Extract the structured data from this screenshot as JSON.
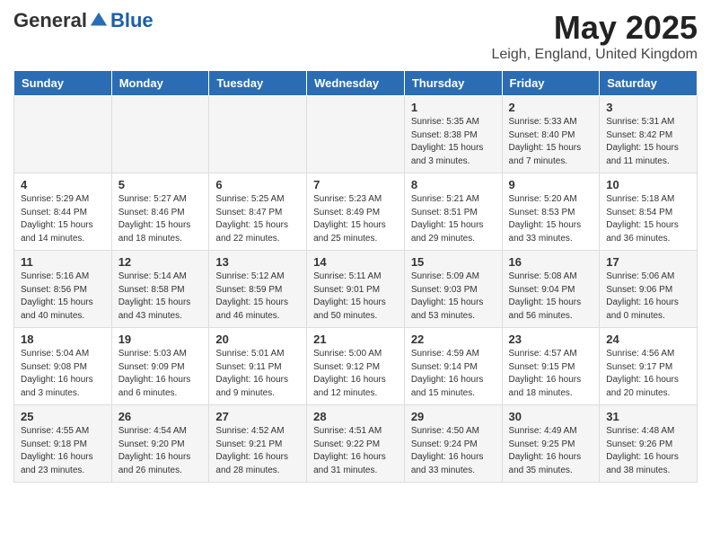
{
  "logo": {
    "general": "General",
    "blue": "Blue"
  },
  "title": "May 2025",
  "location": "Leigh, England, United Kingdom",
  "days_of_week": [
    "Sunday",
    "Monday",
    "Tuesday",
    "Wednesday",
    "Thursday",
    "Friday",
    "Saturday"
  ],
  "weeks": [
    [
      {
        "day": "",
        "info": ""
      },
      {
        "day": "",
        "info": ""
      },
      {
        "day": "",
        "info": ""
      },
      {
        "day": "",
        "info": ""
      },
      {
        "day": "1",
        "info": "Sunrise: 5:35 AM\nSunset: 8:38 PM\nDaylight: 15 hours\nand 3 minutes."
      },
      {
        "day": "2",
        "info": "Sunrise: 5:33 AM\nSunset: 8:40 PM\nDaylight: 15 hours\nand 7 minutes."
      },
      {
        "day": "3",
        "info": "Sunrise: 5:31 AM\nSunset: 8:42 PM\nDaylight: 15 hours\nand 11 minutes."
      }
    ],
    [
      {
        "day": "4",
        "info": "Sunrise: 5:29 AM\nSunset: 8:44 PM\nDaylight: 15 hours\nand 14 minutes."
      },
      {
        "day": "5",
        "info": "Sunrise: 5:27 AM\nSunset: 8:46 PM\nDaylight: 15 hours\nand 18 minutes."
      },
      {
        "day": "6",
        "info": "Sunrise: 5:25 AM\nSunset: 8:47 PM\nDaylight: 15 hours\nand 22 minutes."
      },
      {
        "day": "7",
        "info": "Sunrise: 5:23 AM\nSunset: 8:49 PM\nDaylight: 15 hours\nand 25 minutes."
      },
      {
        "day": "8",
        "info": "Sunrise: 5:21 AM\nSunset: 8:51 PM\nDaylight: 15 hours\nand 29 minutes."
      },
      {
        "day": "9",
        "info": "Sunrise: 5:20 AM\nSunset: 8:53 PM\nDaylight: 15 hours\nand 33 minutes."
      },
      {
        "day": "10",
        "info": "Sunrise: 5:18 AM\nSunset: 8:54 PM\nDaylight: 15 hours\nand 36 minutes."
      }
    ],
    [
      {
        "day": "11",
        "info": "Sunrise: 5:16 AM\nSunset: 8:56 PM\nDaylight: 15 hours\nand 40 minutes."
      },
      {
        "day": "12",
        "info": "Sunrise: 5:14 AM\nSunset: 8:58 PM\nDaylight: 15 hours\nand 43 minutes."
      },
      {
        "day": "13",
        "info": "Sunrise: 5:12 AM\nSunset: 8:59 PM\nDaylight: 15 hours\nand 46 minutes."
      },
      {
        "day": "14",
        "info": "Sunrise: 5:11 AM\nSunset: 9:01 PM\nDaylight: 15 hours\nand 50 minutes."
      },
      {
        "day": "15",
        "info": "Sunrise: 5:09 AM\nSunset: 9:03 PM\nDaylight: 15 hours\nand 53 minutes."
      },
      {
        "day": "16",
        "info": "Sunrise: 5:08 AM\nSunset: 9:04 PM\nDaylight: 15 hours\nand 56 minutes."
      },
      {
        "day": "17",
        "info": "Sunrise: 5:06 AM\nSunset: 9:06 PM\nDaylight: 16 hours\nand 0 minutes."
      }
    ],
    [
      {
        "day": "18",
        "info": "Sunrise: 5:04 AM\nSunset: 9:08 PM\nDaylight: 16 hours\nand 3 minutes."
      },
      {
        "day": "19",
        "info": "Sunrise: 5:03 AM\nSunset: 9:09 PM\nDaylight: 16 hours\nand 6 minutes."
      },
      {
        "day": "20",
        "info": "Sunrise: 5:01 AM\nSunset: 9:11 PM\nDaylight: 16 hours\nand 9 minutes."
      },
      {
        "day": "21",
        "info": "Sunrise: 5:00 AM\nSunset: 9:12 PM\nDaylight: 16 hours\nand 12 minutes."
      },
      {
        "day": "22",
        "info": "Sunrise: 4:59 AM\nSunset: 9:14 PM\nDaylight: 16 hours\nand 15 minutes."
      },
      {
        "day": "23",
        "info": "Sunrise: 4:57 AM\nSunset: 9:15 PM\nDaylight: 16 hours\nand 18 minutes."
      },
      {
        "day": "24",
        "info": "Sunrise: 4:56 AM\nSunset: 9:17 PM\nDaylight: 16 hours\nand 20 minutes."
      }
    ],
    [
      {
        "day": "25",
        "info": "Sunrise: 4:55 AM\nSunset: 9:18 PM\nDaylight: 16 hours\nand 23 minutes."
      },
      {
        "day": "26",
        "info": "Sunrise: 4:54 AM\nSunset: 9:20 PM\nDaylight: 16 hours\nand 26 minutes."
      },
      {
        "day": "27",
        "info": "Sunrise: 4:52 AM\nSunset: 9:21 PM\nDaylight: 16 hours\nand 28 minutes."
      },
      {
        "day": "28",
        "info": "Sunrise: 4:51 AM\nSunset: 9:22 PM\nDaylight: 16 hours\nand 31 minutes."
      },
      {
        "day": "29",
        "info": "Sunrise: 4:50 AM\nSunset: 9:24 PM\nDaylight: 16 hours\nand 33 minutes."
      },
      {
        "day": "30",
        "info": "Sunrise: 4:49 AM\nSunset: 9:25 PM\nDaylight: 16 hours\nand 35 minutes."
      },
      {
        "day": "31",
        "info": "Sunrise: 4:48 AM\nSunset: 9:26 PM\nDaylight: 16 hours\nand 38 minutes."
      }
    ]
  ]
}
